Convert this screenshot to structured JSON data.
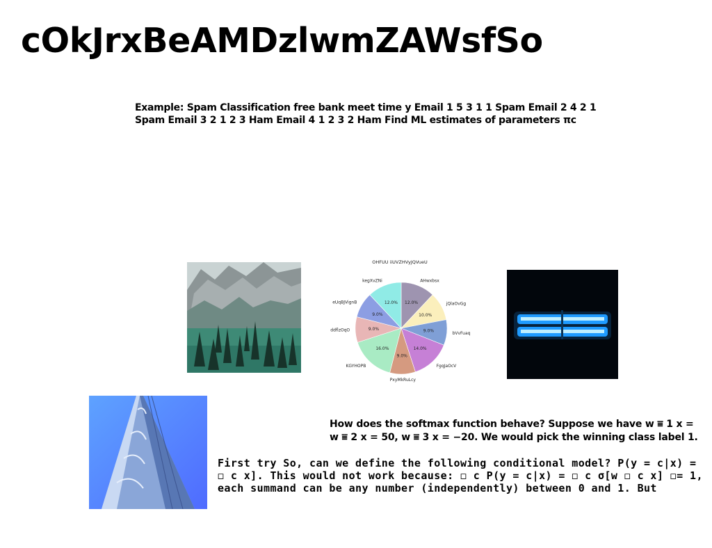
{
  "page": {
    "title": "cOkJrxBeAMDzlwmZAWsfSo",
    "paragraph_1": "Example: Spam Classification free bank meet time y Email 1 5 3 1 1 Spam Email 2 4 2 1 Spam Email 3 2 1 2 3 Ham Email 4 1 2 3 2 Ham Find ML estimates of parameters πc",
    "paragraph_2_line_1": "How does the softmax function behave? Suppose we have w ⩸ 1 x =",
    "paragraph_2_line_2": "w ⩸ 2 x = 50, w ⩸ 3 x = −20. We would pick the winning class label 1.",
    "paragraph_3": "First try So, can we define the following conditional model? P(y = c|x) = ◻ c x]. This would not work because: ◻ c P(y = c|x) = ◻ c σ[w ◻ c x] ◻= 1, each summand can be any number (independently) between 0 and 1. But"
  },
  "images": {
    "mountain": "mountain-forest-photo",
    "tube": "glowing-blue-tube-photo",
    "building": "blue-skyscraper-photo"
  },
  "chart_data": {
    "type": "pie",
    "title": "OHFUU iiUVZHVyJQVueU",
    "slices": [
      {
        "label": "AHwxbsx",
        "value": 12.0,
        "pct_label": "12.0%",
        "color": "#9e94b0"
      },
      {
        "label": "jQlaOvGg",
        "value": 10.0,
        "pct_label": "10.0%",
        "color": "#fbefbc"
      },
      {
        "label": "bVvFuaq",
        "value": 9.0,
        "pct_label": "9.0%",
        "color": "#7f9fd6"
      },
      {
        "label": "FgqJaOcV",
        "value": 14.0,
        "pct_label": "14.0%",
        "color": "#c680d6"
      },
      {
        "label": "PxyMkRuLcy",
        "value": 9.0,
        "pct_label": "9.0%",
        "color": "#d59a80"
      },
      {
        "label": "KGYHOPB",
        "value": 16.0,
        "pct_label": "16.0%",
        "color": "#a9ebc4"
      },
      {
        "label": "ddflzOqO",
        "value": 9.0,
        "pct_label": "9.0%",
        "color": "#e8b6b6"
      },
      {
        "label": "eUqBJVignB",
        "value": 9.0,
        "pct_label": "9.0%",
        "color": "#8c9ee3"
      },
      {
        "label": "kegXvZNi",
        "value": 12.0,
        "pct_label": "12.0%",
        "color": "#90ebe6"
      }
    ],
    "start_angle_deg": 90,
    "direction": "clockwise"
  }
}
